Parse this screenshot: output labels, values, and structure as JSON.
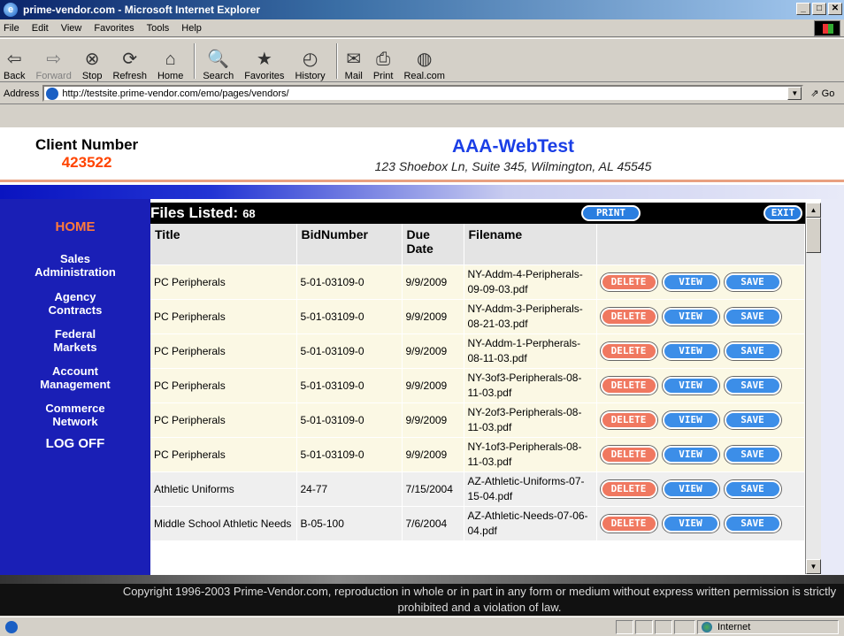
{
  "window": {
    "title": "prime-vendor.com - Microsoft Internet Explorer"
  },
  "menu": [
    "File",
    "Edit",
    "View",
    "Favorites",
    "Tools",
    "Help"
  ],
  "toolbar": [
    {
      "label": "Back",
      "icon": "back-arrow-icon",
      "glyph": "⇦"
    },
    {
      "label": "Forward",
      "icon": "forward-arrow-icon",
      "glyph": "⇨"
    },
    {
      "label": "Stop",
      "icon": "stop-icon",
      "glyph": "⊗"
    },
    {
      "label": "Refresh",
      "icon": "refresh-icon",
      "glyph": "⟳"
    },
    {
      "label": "Home",
      "icon": "home-icon",
      "glyph": "⌂"
    },
    {
      "label": "Search",
      "icon": "search-icon",
      "glyph": "🔍"
    },
    {
      "label": "Favorites",
      "icon": "favorites-icon",
      "glyph": "★"
    },
    {
      "label": "History",
      "icon": "history-icon",
      "glyph": "◴"
    },
    {
      "label": "Mail",
      "icon": "mail-icon",
      "glyph": "✉"
    },
    {
      "label": "Print",
      "icon": "print-icon",
      "glyph": "⎙"
    },
    {
      "label": "Real.com",
      "icon": "realcom-icon",
      "glyph": "◍"
    }
  ],
  "address": {
    "label": "Address",
    "url": "http://testsite.prime-vendor.com/emo/pages/vendors/",
    "go": "Go"
  },
  "header": {
    "client_label": "Client Number",
    "client_number": "423522",
    "company": "AAA-WebTest",
    "company_address": "123 Shoebox Ln, Suite 345, Wilmington, AL 45545"
  },
  "nav": {
    "home": "HOME",
    "sales": [
      "Sales",
      "Administration"
    ],
    "agency": [
      "Agency",
      "Contracts"
    ],
    "federal": [
      "Federal",
      "Markets"
    ],
    "account": [
      "Account",
      "Management"
    ],
    "commerce": [
      "Commerce",
      "Network"
    ],
    "logoff": "LOG OFF"
  },
  "list": {
    "title": "Files Listed:",
    "count": "68",
    "print": "PRINT",
    "exit": "EXIT",
    "columns": [
      "Title",
      "BidNumber",
      "Due Date",
      "Filename",
      ""
    ],
    "actions": {
      "delete": "DELETE",
      "view": "VIEW",
      "save": "SAVE"
    },
    "rows": [
      {
        "title": "PC Peripherals",
        "bid": "5-01-03109-0",
        "due": "9/9/2009",
        "file": "NY-Addm-4-Peripherals-09-09-03.pdf"
      },
      {
        "title": "PC Peripherals",
        "bid": "5-01-03109-0",
        "due": "9/9/2009",
        "file": "NY-Addm-3-Peripherals-08-21-03.pdf"
      },
      {
        "title": "PC Peripherals",
        "bid": "5-01-03109-0",
        "due": "9/9/2009",
        "file": "NY-Addm-1-Perpherals-08-11-03.pdf"
      },
      {
        "title": "PC Peripherals",
        "bid": "5-01-03109-0",
        "due": "9/9/2009",
        "file": "NY-3of3-Peripherals-08-11-03.pdf"
      },
      {
        "title": "PC Peripherals",
        "bid": "5-01-03109-0",
        "due": "9/9/2009",
        "file": "NY-2of3-Peripherals-08-11-03.pdf"
      },
      {
        "title": "PC Peripherals",
        "bid": "5-01-03109-0",
        "due": "9/9/2009",
        "file": "NY-1of3-Peripherals-08-11-03.pdf"
      },
      {
        "title": "Athletic Uniforms",
        "bid": "24-77",
        "due": "7/15/2004",
        "file": "AZ-Athletic-Uniforms-07-15-04.pdf"
      },
      {
        "title": "Middle School Athletic Needs",
        "bid": "B-05-100",
        "due": "7/6/2004",
        "file": "AZ-Athletic-Needs-07-06-04.pdf"
      }
    ]
  },
  "footer": {
    "copyright": "Copyright 1996-2003 Prime-Vendor.com, reproduction in whole or in part in any form or medium without express written permission is strictly prohibited and a violation of law."
  },
  "status": {
    "zone": "Internet"
  }
}
